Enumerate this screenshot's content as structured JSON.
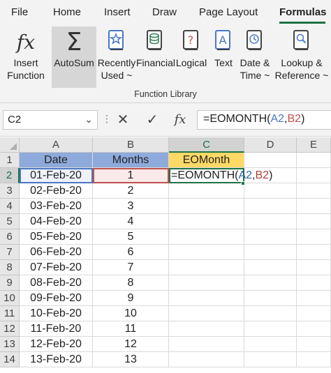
{
  "tabs": [
    {
      "label": "File"
    },
    {
      "label": "Home"
    },
    {
      "label": "Insert"
    },
    {
      "label": "Draw"
    },
    {
      "label": "Page Layout"
    },
    {
      "label": "Formulas"
    }
  ],
  "active_tab": "Formulas",
  "ribbon": {
    "buttons": [
      {
        "line1": "Insert",
        "line2": "Function",
        "icon": "fx-icon"
      },
      {
        "line1": "AutoSum",
        "line2": "",
        "icon": "sigma-icon"
      },
      {
        "line1": "Recently",
        "line2": "Used ~",
        "icon": "star-book-icon"
      },
      {
        "line1": "Financial",
        "line2": "",
        "icon": "database-book-icon"
      },
      {
        "line1": "Logical",
        "line2": "",
        "icon": "question-book-icon"
      },
      {
        "line1": "Text",
        "line2": "",
        "icon": "a-book-icon"
      },
      {
        "line1": "Date &",
        "line2": "Time ~",
        "icon": "clock-book-icon"
      },
      {
        "line1": "Lookup &",
        "line2": "Reference ~",
        "icon": "magnifier-book-icon"
      }
    ],
    "group_label": "Function Library"
  },
  "formula_bar": {
    "name_box": "C2",
    "fx_symbol": "fx",
    "formula_prefix": "=EOMONTH(",
    "formula_ref1": "A2",
    "formula_sep": ",",
    "formula_ref2": "B2",
    "formula_suffix": ")"
  },
  "grid": {
    "columns": [
      "A",
      "B",
      "C",
      "D",
      "E"
    ],
    "headers": {
      "date": "Date",
      "months": "Months",
      "eomonth": "EOMonth"
    },
    "rows": [
      {
        "n": "1"
      },
      {
        "n": "2",
        "date": "01-Feb-20",
        "months": "1"
      },
      {
        "n": "3",
        "date": "02-Feb-20",
        "months": "2"
      },
      {
        "n": "4",
        "date": "03-Feb-20",
        "months": "3"
      },
      {
        "n": "5",
        "date": "04-Feb-20",
        "months": "4"
      },
      {
        "n": "6",
        "date": "05-Feb-20",
        "months": "5"
      },
      {
        "n": "7",
        "date": "06-Feb-20",
        "months": "6"
      },
      {
        "n": "8",
        "date": "07-Feb-20",
        "months": "7"
      },
      {
        "n": "9",
        "date": "08-Feb-20",
        "months": "8"
      },
      {
        "n": "10",
        "date": "09-Feb-20",
        "months": "9"
      },
      {
        "n": "11",
        "date": "10-Feb-20",
        "months": "10"
      },
      {
        "n": "12",
        "date": "11-Feb-20",
        "months": "11"
      },
      {
        "n": "13",
        "date": "12-Feb-20",
        "months": "12"
      },
      {
        "n": "14",
        "date": "13-Feb-20",
        "months": "13"
      }
    ],
    "c2_formula": {
      "prefix": "=EOMONTH(",
      "ref1": "A2",
      "sep": ",",
      "ref2": "B2",
      "suffix": ")"
    }
  },
  "colors": {
    "accent": "#1e7145",
    "header_blue": "#8eaadb",
    "header_yellow": "#ffd966",
    "ref_blue": "#4a77c4",
    "ref_red": "#c0504d"
  }
}
